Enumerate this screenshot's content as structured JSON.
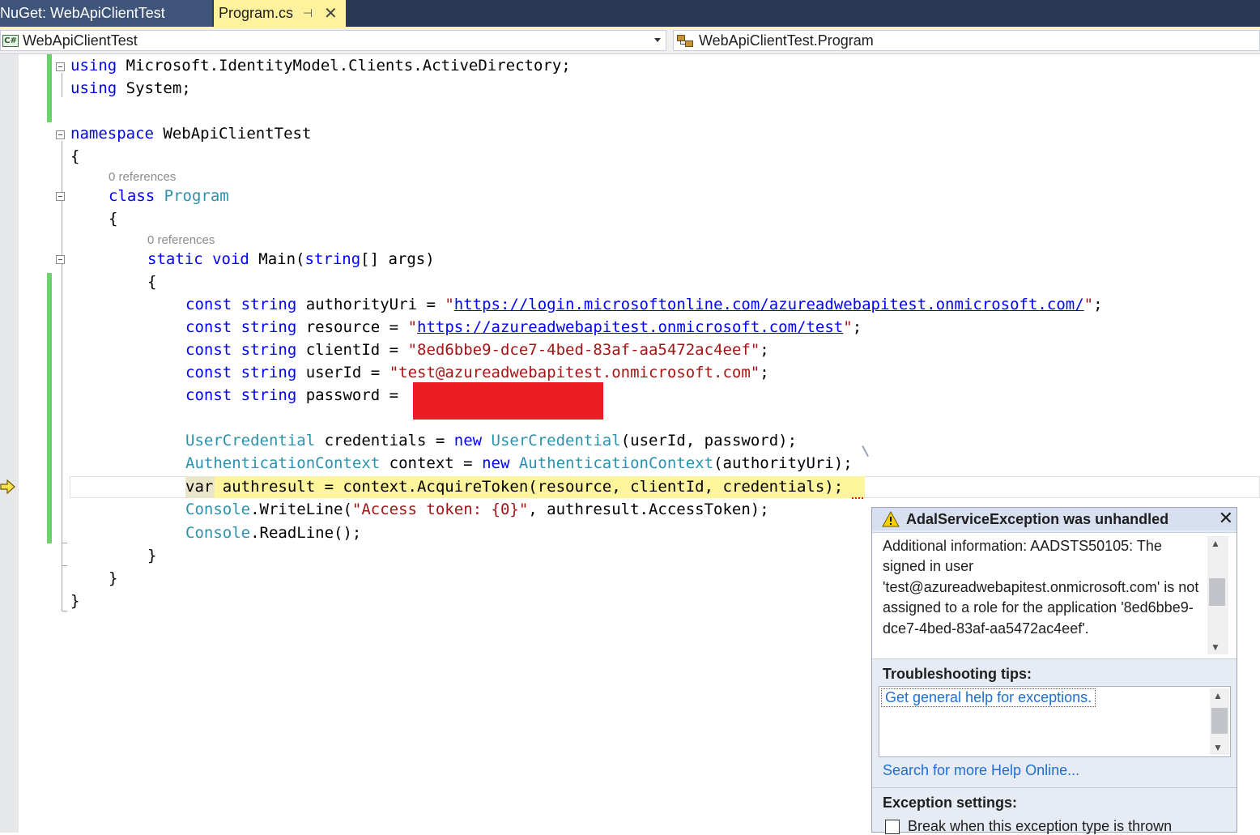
{
  "tabs": {
    "nuget": "NuGet: WebApiClientTest",
    "program": "Program.cs",
    "pin_icon": "pin-icon",
    "close_icon": "close-icon"
  },
  "navbar": {
    "project": "WebApiClientTest",
    "type": "WebApiClientTest.Program"
  },
  "editor": {
    "codelens_class": "0 references",
    "codelens_main": "0 references",
    "lines": {
      "l1_kw": "using",
      "l1_rest": " Microsoft.IdentityModel.Clients.ActiveDirectory;",
      "l2_kw": "using",
      "l2_rest": " System;",
      "l3_kw": "namespace",
      "l3_rest": " WebApiClientTest",
      "l4": "{",
      "l5_kw": "class",
      "l5_ty": "Program",
      "l6": "{",
      "l7_kw1": "static",
      "l7_kw2": "void",
      "l7_mid": " Main(",
      "l7_kw3": "string",
      "l7_rest": "[] args)",
      "l8": "{",
      "l9_kw1": "const",
      "l9_kw2": "string",
      "l9_mid": " authorityUri = ",
      "l9_q1": "\"",
      "l9_link": "https://login.microsoftonline.com/azureadwebapitest.onmicrosoft.com/",
      "l9_q2": "\"",
      "l9_end": ";",
      "l10_kw1": "const",
      "l10_kw2": "string",
      "l10_mid": " resource = ",
      "l10_q1": "\"",
      "l10_link": "https://azureadwebapitest.onmicrosoft.com/test",
      "l10_q2": "\"",
      "l10_end": ";",
      "l11_kw1": "const",
      "l11_kw2": "string",
      "l11_mid": " clientId = ",
      "l11_str": "\"8ed6bbe9-dce7-4bed-83af-aa5472ac4eef\"",
      "l11_end": ";",
      "l12_kw1": "const",
      "l12_kw2": "string",
      "l12_mid": " userId = ",
      "l12_str": "\"test@azureadwebapitest.onmicrosoft.com\"",
      "l12_end": ";",
      "l13_kw1": "const",
      "l13_kw2": "string",
      "l13_mid": " password = ",
      "l14_ty1": "UserCredential",
      "l14_mid": " credentials = ",
      "l14_kw": "new",
      "l14_ty2": "UserCredential",
      "l14_rest": "(userId, password);",
      "l15_ty1": "AuthenticationContext",
      "l15_mid": " context = ",
      "l15_kw": "new",
      "l15_ty2": "AuthenticationContext",
      "l15_rest": "(authorityUri);",
      "l16_kw": "var",
      "l16_rest": " authresult = context.AcquireToken(resource, clientId, credentials);",
      "l17_ty": "Console",
      "l17_mid": ".WriteLine(",
      "l17_str": "\"Access token: {0}\"",
      "l17_rest": ", authresult.AccessToken);",
      "l18_ty": "Console",
      "l18_rest": ".ReadLine();",
      "l19": "}",
      "l20": "}",
      "l21": "}"
    }
  },
  "exception": {
    "title": "AdalServiceException was unhandled",
    "info": "Additional information: AADSTS50105: The signed in user 'test@azureadwebapitest.onmicrosoft.com' is not assigned to a role for the application '8ed6bbe9-dce7-4bed-83af-aa5472ac4eef'.",
    "tips_label": "Troubleshooting tips:",
    "tips_link": "Get general help for exceptions.",
    "help_link": "Search for more Help Online...",
    "settings_label": "Exception settings:",
    "checkbox_label": "Break when this exception type is thrown",
    "checkbox_checked": false
  },
  "colors": {
    "tab_active": "#fff29d",
    "tab_bar": "#293955",
    "keyword": "#0000ff",
    "type": "#2b91af",
    "string": "#a31515",
    "current_statement": "#fff59d",
    "redaction": "#ee1c25",
    "change_bar": "#6ad26a"
  }
}
